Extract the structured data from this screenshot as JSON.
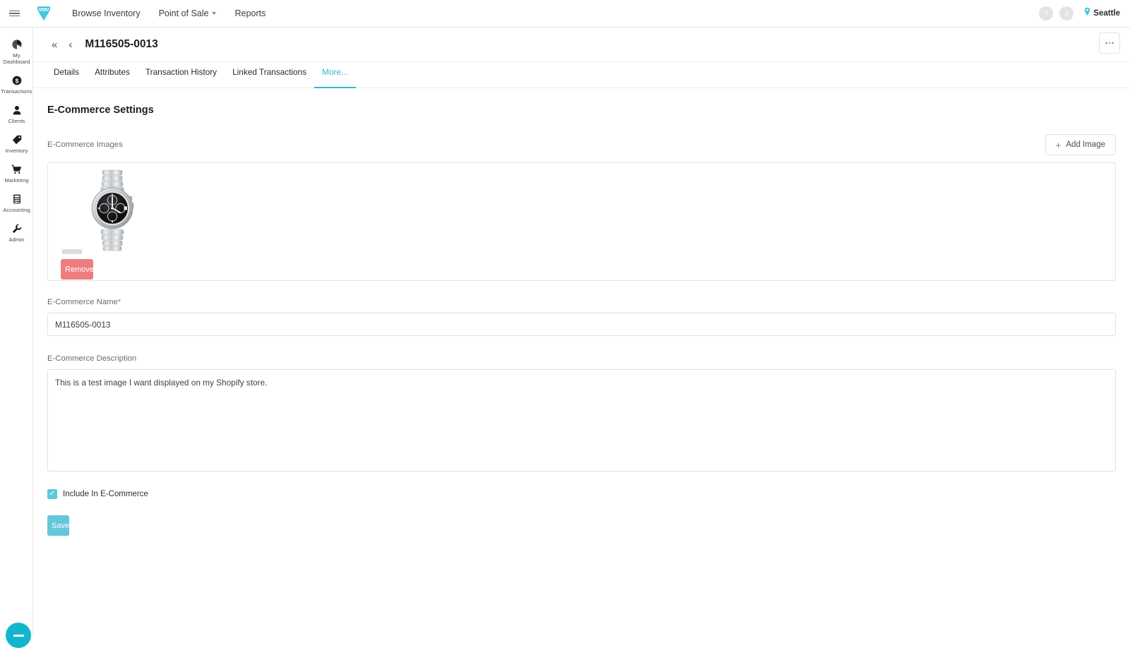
{
  "topbar": {
    "menu_icon": "hamburger-icon",
    "logo_icon": "gem-logo-icon",
    "nav": [
      {
        "label": "Browse Inventory",
        "has_caret": false
      },
      {
        "label": "Point of Sale",
        "has_caret": true
      },
      {
        "label": "Reports",
        "has_caret": false
      }
    ],
    "help_label": "?",
    "avatar_initial": "J",
    "location_icon": "map-pin-icon",
    "location": "Seattle"
  },
  "sidebar": {
    "items": [
      {
        "label": "My Dashboard",
        "icon": "pie-chart-icon",
        "glyph": "◕"
      },
      {
        "label": "Transactions",
        "icon": "coin-dollar-icon",
        "glyph": "◉"
      },
      {
        "label": "Clients",
        "icon": "person-icon",
        "glyph": "👤"
      },
      {
        "label": "Inventory",
        "icon": "tag-icon",
        "glyph": "🏷"
      },
      {
        "label": "Marketing",
        "icon": "shopping-cart-icon",
        "glyph": "🛒"
      },
      {
        "label": "Accounting",
        "icon": "calculator-icon",
        "glyph": "▤"
      },
      {
        "label": "Admin",
        "icon": "wrench-icon",
        "glyph": "🔧"
      }
    ],
    "fab_icon": "minus-fab-icon"
  },
  "page": {
    "collapse_icon": "double-chevron-left-icon",
    "back_icon": "chevron-left-icon",
    "title": "M116505-0013",
    "kebab_icon": "more-horizontal-icon"
  },
  "tabs": [
    {
      "label": "Details",
      "active": false
    },
    {
      "label": "Attributes",
      "active": false
    },
    {
      "label": "Transaction History",
      "active": false
    },
    {
      "label": "Linked Transactions",
      "active": false
    },
    {
      "label": "More...",
      "active": true
    }
  ],
  "main": {
    "section_title": "E-Commerce Settings",
    "images_label": "E-Commerce Images",
    "add_image_label": "Add Image",
    "add_image_icon": "plus-icon",
    "image_item": {
      "alt": "silver-chronograph-watch-thumbnail",
      "remove_label": "Remove"
    },
    "name_label": "E-Commerce Name",
    "required_marker": "*",
    "name_value": "M116505-0013",
    "description_label": "E-Commerce Description",
    "description_value": "This is a test image I want displayed on my Shopify store.",
    "include_checkbox": {
      "label": "Include In E-Commerce",
      "checked": true,
      "check_glyph": "✓"
    },
    "save_label": "Save"
  },
  "colors": {
    "accent_teal": "#35b6cf",
    "fab_teal": "#13b5cd",
    "save_teal": "#63c6db",
    "checkbox_teal": "#5ec8de",
    "remove_red": "#ef7d7d",
    "required_red": "#e8604c",
    "border_grey": "#e4e4e4"
  }
}
